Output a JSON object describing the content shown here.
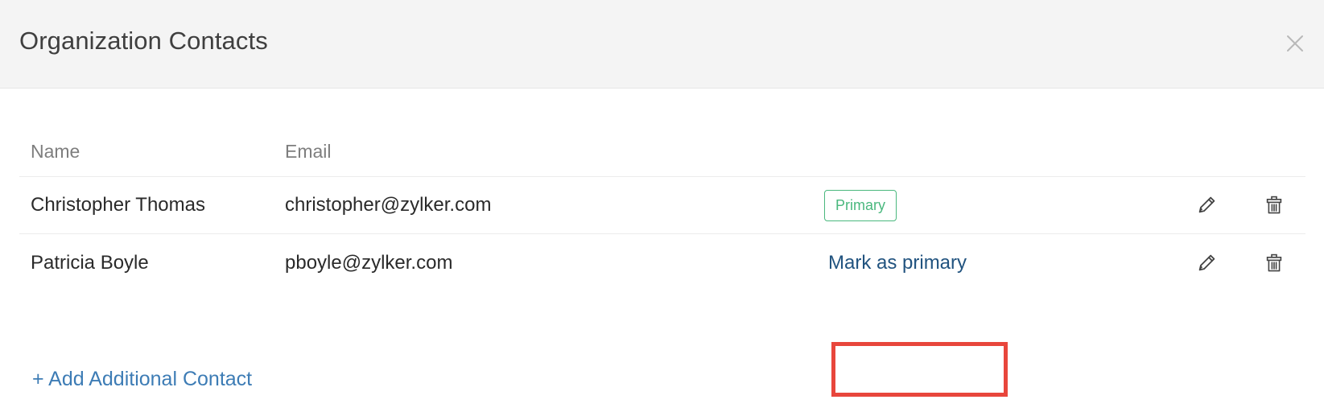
{
  "dialog": {
    "title": "Organization Contacts",
    "close_icon": "close-icon"
  },
  "table": {
    "columns": [
      {
        "key": "name",
        "label": "Name"
      },
      {
        "key": "email",
        "label": "Email"
      },
      {
        "key": "status",
        "label": ""
      },
      {
        "key": "actions",
        "label": ""
      }
    ],
    "rows": [
      {
        "name": "Christopher Thomas",
        "email": "christopher@zylker.com",
        "status_type": "badge",
        "status_label": "Primary",
        "edit_icon": "pencil-icon",
        "delete_icon": "trash-icon"
      },
      {
        "name": "Patricia Boyle",
        "email": "pboyle@zylker.com",
        "status_type": "link",
        "status_label": "Mark as primary",
        "edit_icon": "pencil-icon",
        "delete_icon": "trash-icon"
      }
    ]
  },
  "footer": {
    "add_contact_label": "+ Add Additional Contact"
  },
  "colors": {
    "header_background": "#f4f4f4",
    "title_text": "#3f3f3f",
    "column_header_text": "#7e7e7e",
    "cell_text": "#2a2a2a",
    "badge_green": "#4ab87e",
    "link_blue_dark": "#21537f",
    "link_blue": "#3d7cb5",
    "annotation_red": "#e8463c",
    "divider": "#ececec"
  }
}
